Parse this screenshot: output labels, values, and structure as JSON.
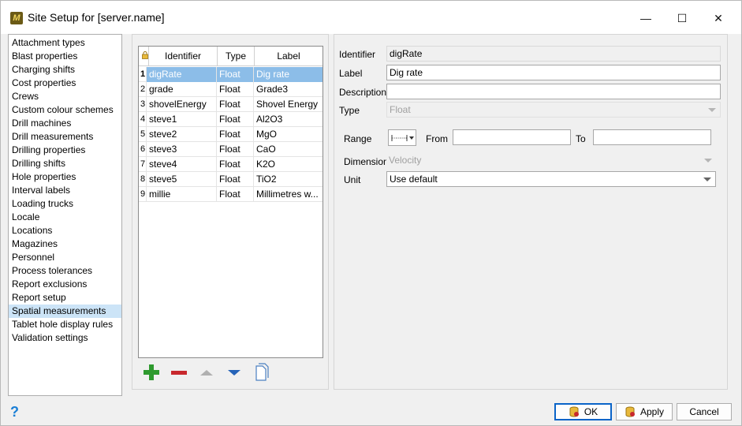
{
  "window": {
    "title": "Site Setup for [server.name]",
    "minimize": "—",
    "maximize": "☐",
    "close": "✕"
  },
  "sidebar": {
    "items": [
      "Attachment types",
      "Blast properties",
      "Charging shifts",
      "Cost properties",
      "Crews",
      "Custom colour schemes",
      "Drill machines",
      "Drill measurements",
      "Drilling properties",
      "Drilling shifts",
      "Hole properties",
      "Interval labels",
      "Loading trucks",
      "Locale",
      "Locations",
      "Magazines",
      "Personnel",
      "Process tolerances",
      "Report exclusions",
      "Report setup",
      "Spatial measurements",
      "Tablet hole display rules",
      "Validation settings"
    ],
    "selected_index": 20
  },
  "grid": {
    "columns": {
      "identifier": "Identifier",
      "type": "Type",
      "label": "Label"
    },
    "rows": [
      {
        "num": "1",
        "identifier": "digRate",
        "type": "Float",
        "label": "Dig rate"
      },
      {
        "num": "2",
        "identifier": "grade",
        "type": "Float",
        "label": "Grade3"
      },
      {
        "num": "3",
        "identifier": "shovelEnergy",
        "type": "Float",
        "label": "Shovel Energy"
      },
      {
        "num": "4",
        "identifier": "steve1",
        "type": "Float",
        "label": "Al2O3"
      },
      {
        "num": "5",
        "identifier": "steve2",
        "type": "Float",
        "label": "MgO"
      },
      {
        "num": "6",
        "identifier": "steve3",
        "type": "Float",
        "label": "CaO"
      },
      {
        "num": "7",
        "identifier": "steve4",
        "type": "Float",
        "label": "K2O"
      },
      {
        "num": "8",
        "identifier": "steve5",
        "type": "Float",
        "label": "TiO2"
      },
      {
        "num": "9",
        "identifier": "millie",
        "type": "Float",
        "label": "Millimetres w..."
      }
    ],
    "selected_index": 0
  },
  "details": {
    "identifier_label": "Identifier",
    "identifier_value": "digRate",
    "label_label": "Label",
    "label_value": "Dig rate",
    "description_label": "Description",
    "description_value": "",
    "type_label": "Type",
    "type_value": "Float",
    "range_label": "Range",
    "from_label": "From",
    "from_value": "",
    "to_label": "To",
    "to_value": "",
    "dimension_label": "Dimension",
    "dimension_value": "Velocity",
    "unit_label": "Unit",
    "unit_value": "Use default"
  },
  "footer": {
    "ok": "OK",
    "apply": "Apply",
    "cancel": "Cancel",
    "help": "?"
  },
  "colors": {
    "selection": "#8cbde8",
    "sidebar_selection": "#cce4f7",
    "add": "#2e9a2e",
    "remove": "#c8282d",
    "help": "#1a7fd6"
  }
}
